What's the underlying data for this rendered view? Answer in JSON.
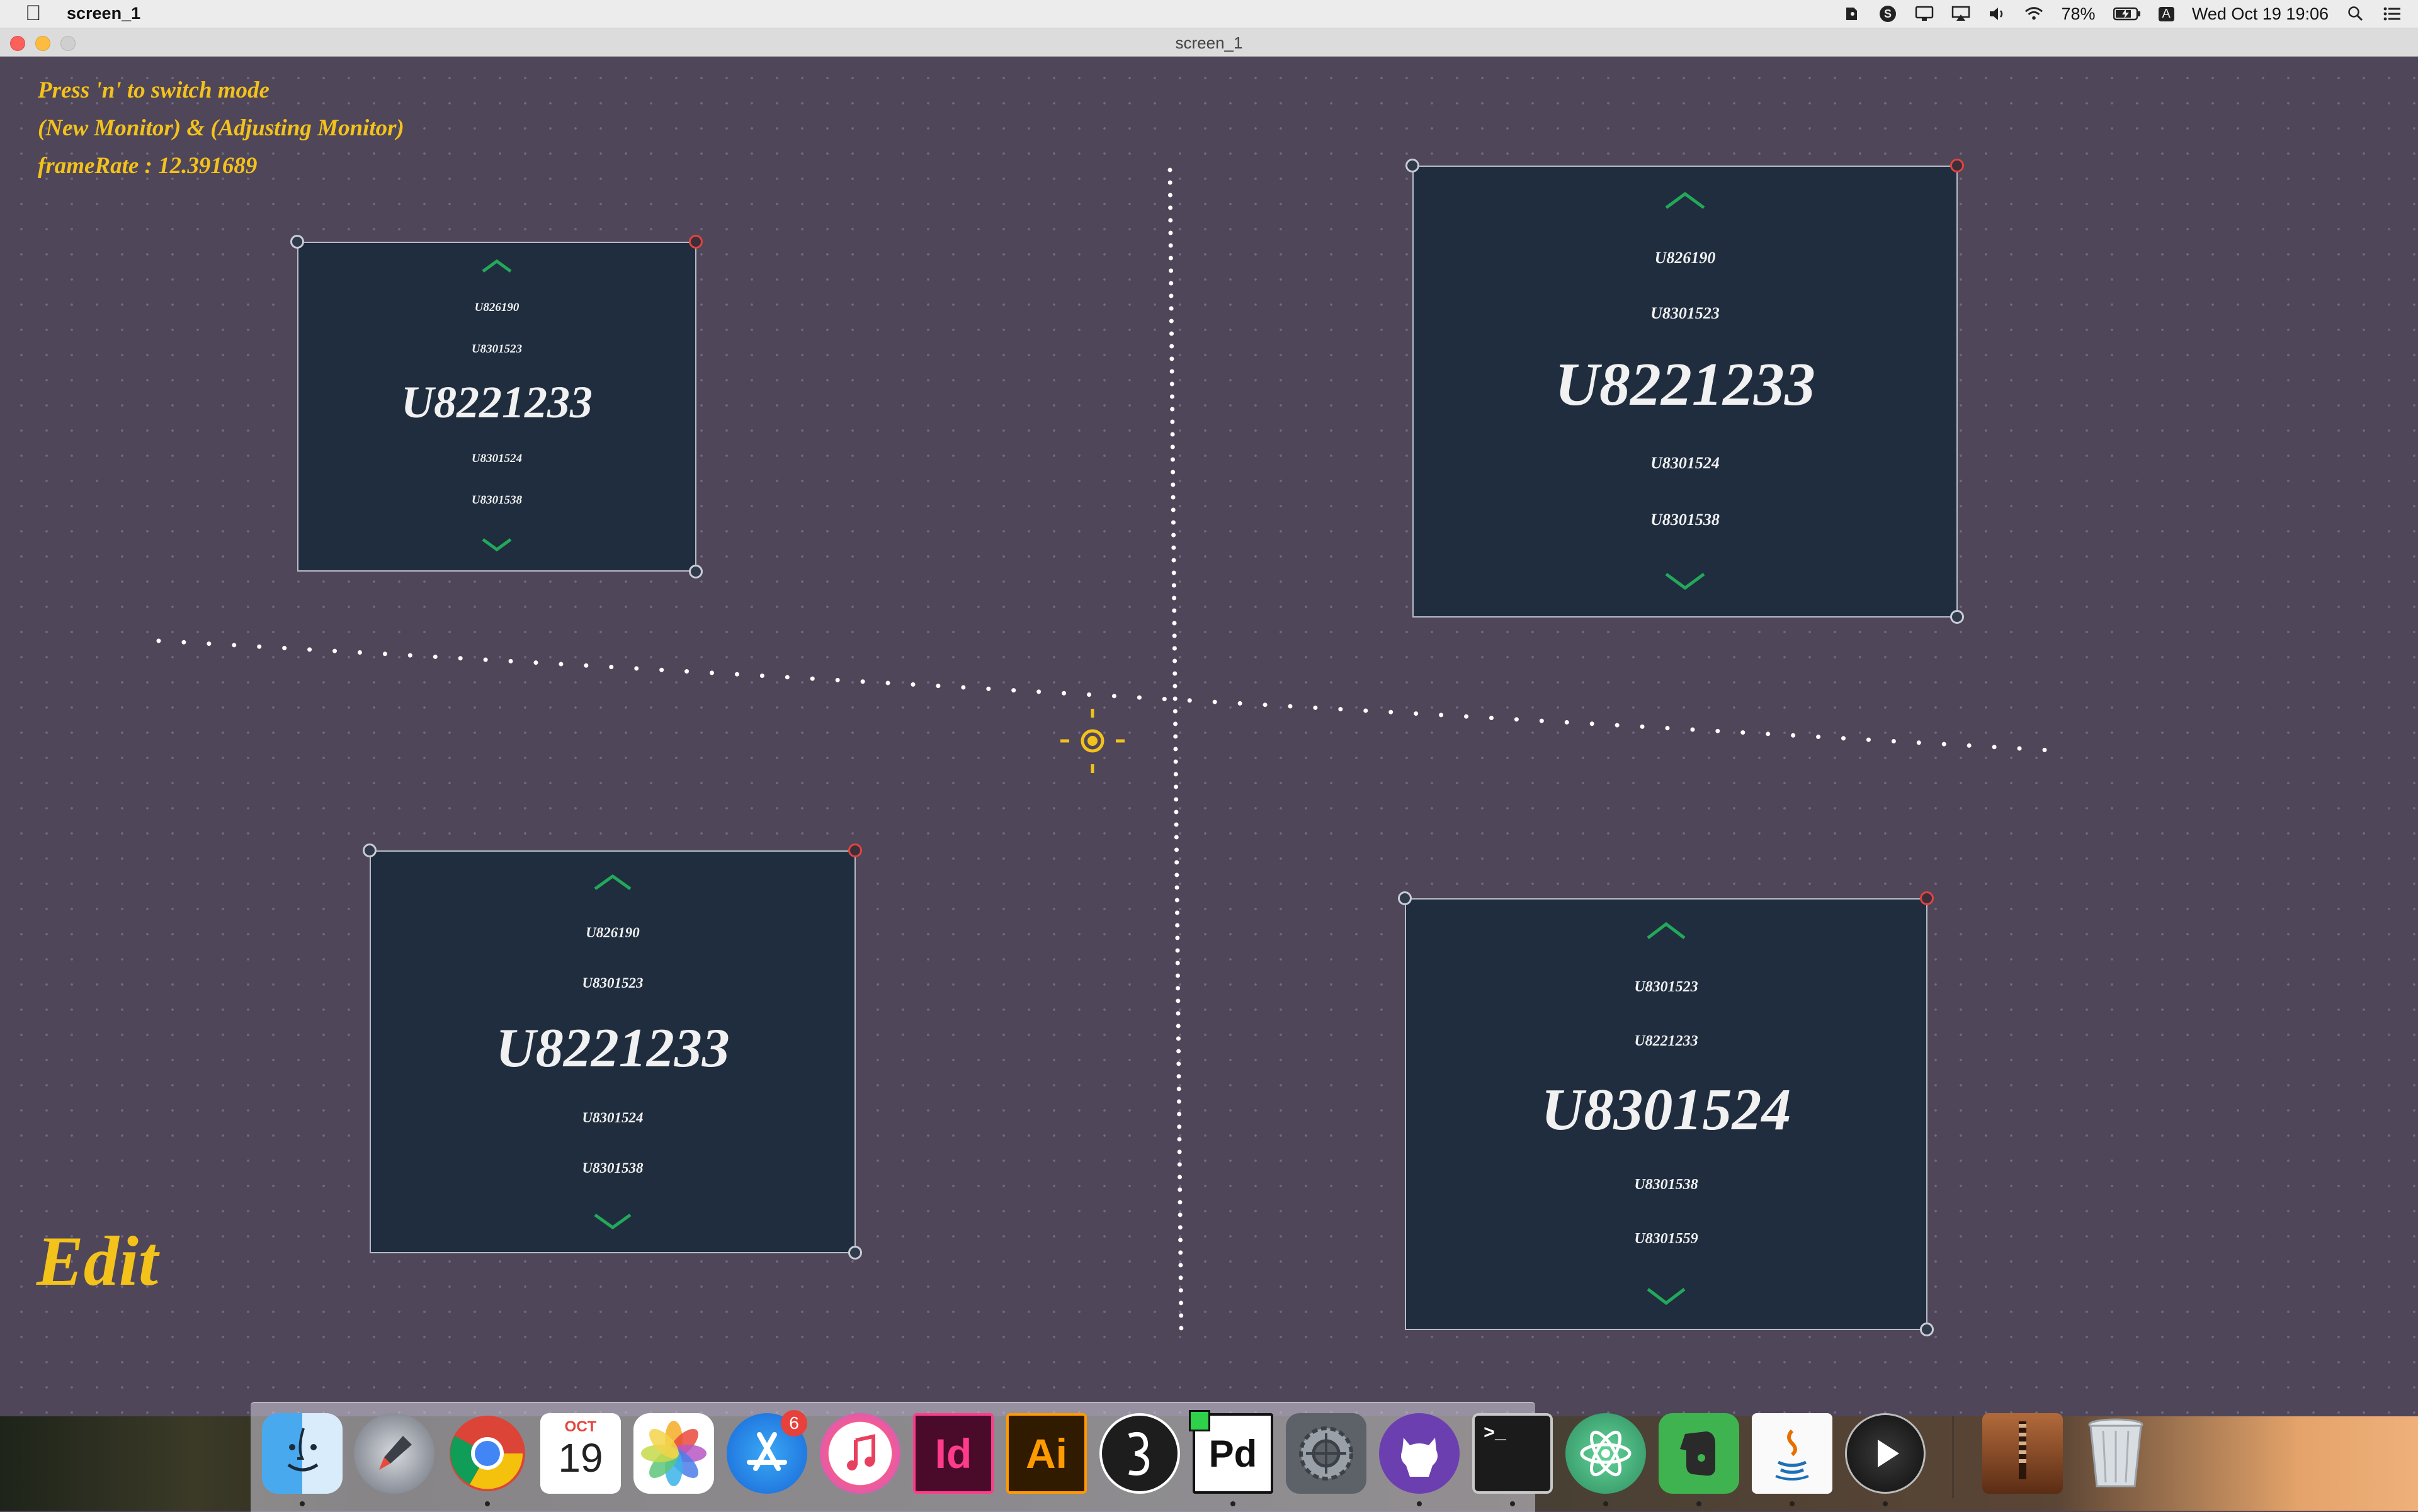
{
  "menubar": {
    "app_name": "screen_1",
    "battery": "78%",
    "keyboard_layout": "A",
    "datetime": "Wed Oct 19  19:06"
  },
  "window": {
    "title": "screen_1"
  },
  "hud": {
    "line1": "Press 'n' to switch mode",
    "line2": "(New Monitor) & (Adjusting Monitor)",
    "line3": "frameRate : 12.391689"
  },
  "edit_label": "Edit",
  "monitors": [
    {
      "above2": "U826190",
      "above1": "U8301523",
      "current": "U8221233",
      "below1": "U8301524",
      "below2": "U8301538"
    },
    {
      "above2": "U826190",
      "above1": "U8301523",
      "current": "U8221233",
      "below1": "U8301524",
      "below2": "U8301538"
    },
    {
      "above2": "U826190",
      "above1": "U8301523",
      "current": "U8221233",
      "below1": "U8301524",
      "below2": "U8301538"
    },
    {
      "above2": "U8301523",
      "above1": "U8221233",
      "current": "U8301524",
      "below1": "U8301538",
      "below2": "U8301559"
    }
  ],
  "colors": {
    "canvas_bg": "#4f4659",
    "monitor_bg": "#1f2d3e",
    "accent_yellow": "#f3c21b",
    "chevron_green": "#23a85a",
    "handle_red": "#e0443e"
  },
  "dock": {
    "apps": [
      "Finder",
      "Launchpad",
      "Google Chrome",
      "Calendar",
      "Photos",
      "App Store",
      "iTunes",
      "InDesign",
      "Illustrator",
      "Processing",
      "Pure Data",
      "System Preferences",
      "GitHub Desktop",
      "Terminal",
      "Atom",
      "Evernote",
      "Java",
      "QuickTime Player",
      "Archive Utility",
      "Trash"
    ],
    "calendar_month": "OCT",
    "calendar_day": "19",
    "appstore_badge": "6",
    "indesign_label": "Id",
    "illustrator_label": "Ai",
    "pd_label": "Pd"
  }
}
